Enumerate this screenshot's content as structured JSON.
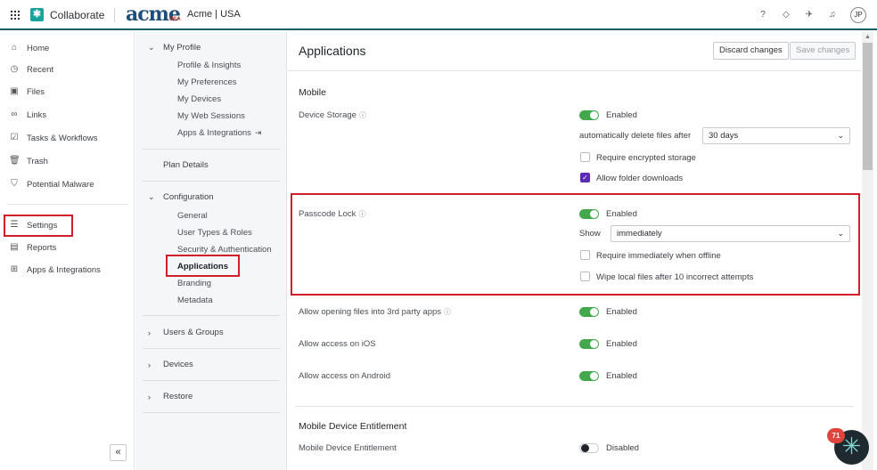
{
  "topbar": {
    "app_name": "Collaborate",
    "logo_text": "acme",
    "logo_sub": "USA",
    "tenant": "Acme | USA",
    "user_initials": "JP"
  },
  "leftnav": {
    "items": [
      {
        "label": "Home",
        "icon": "home-icon"
      },
      {
        "label": "Recent",
        "icon": "clock-icon"
      },
      {
        "label": "Files",
        "icon": "files-icon"
      },
      {
        "label": "Links",
        "icon": "link-icon"
      },
      {
        "label": "Tasks & Workflows",
        "icon": "tasks-icon"
      },
      {
        "label": "Trash",
        "icon": "trash-icon"
      },
      {
        "label": "Potential Malware",
        "icon": "shield-icon"
      },
      {
        "label": "Settings",
        "icon": "sliders-icon"
      },
      {
        "label": "Reports",
        "icon": "report-icon"
      },
      {
        "label": "Apps & Integrations",
        "icon": "apps-icon"
      }
    ],
    "collapse_glyph": "«"
  },
  "midnav": {
    "my_profile": "My Profile",
    "profile_items": [
      "Profile & Insights",
      "My Preferences",
      "My Devices",
      "My Web Sessions",
      "Apps & Integrations"
    ],
    "plan_details": "Plan Details",
    "configuration": "Configuration",
    "config_items": [
      "General",
      "User Types & Roles",
      "Security & Authentication",
      "Applications",
      "Branding",
      "Metadata"
    ],
    "users_groups": "Users & Groups",
    "devices": "Devices",
    "restore": "Restore"
  },
  "main": {
    "title": "Applications",
    "discard": "Discard changes",
    "save": "Save changes",
    "mobile_section": "Mobile",
    "device_storage": "Device Storage",
    "device_storage_toggle": "Enabled",
    "auto_delete_label": "automatically delete files after",
    "auto_delete_value": "30 days",
    "require_encrypted": "Require encrypted storage",
    "allow_folder_downloads": "Allow folder downloads",
    "passcode_lock": "Passcode Lock",
    "passcode_toggle": "Enabled",
    "show_label": "Show",
    "show_value": "immediately",
    "require_offline": "Require immediately when offline",
    "wipe_local": "Wipe local files after 10 incorrect attempts",
    "third_party": "Allow opening files into 3rd party apps",
    "third_party_toggle": "Enabled",
    "ios": "Allow access on iOS",
    "ios_toggle": "Enabled",
    "android": "Allow access on Android",
    "android_toggle": "Enabled",
    "entitlement_section": "Mobile Device Entitlement",
    "entitlement_label": "Mobile Device Entitlement",
    "entitlement_toggle": "Disabled"
  },
  "assistant": {
    "badge": "71"
  },
  "colors": {
    "accent_teal": "#1aa39c",
    "toggle_on": "#43a84b",
    "highlight": "#d11f2a",
    "checkbox": "#5b2bb5"
  }
}
